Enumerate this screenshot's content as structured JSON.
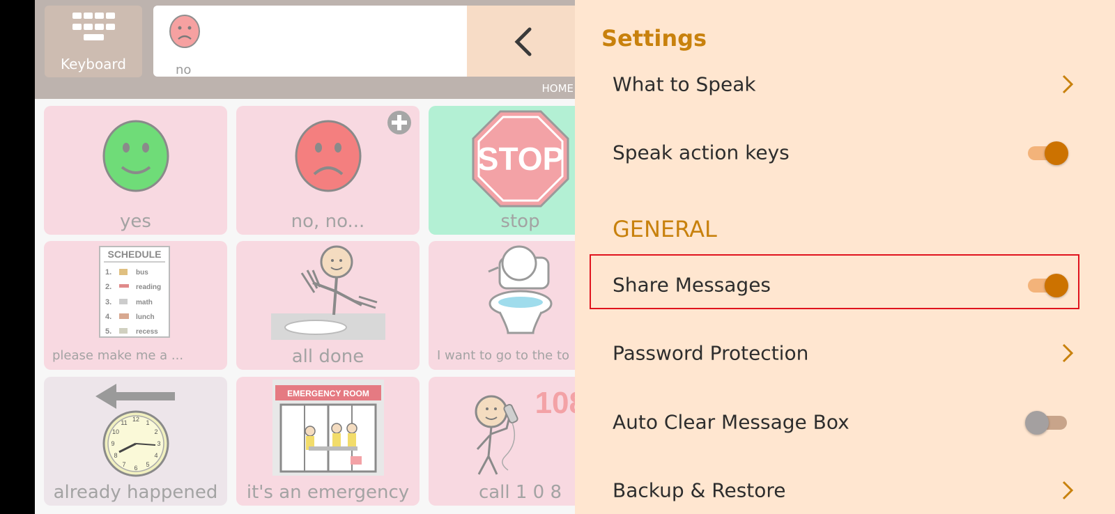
{
  "left": {
    "keyboard_label": "Keyboard",
    "message_word": "no",
    "home_label": "HOME",
    "tiles": [
      {
        "label": "yes"
      },
      {
        "label": "no, no..."
      },
      {
        "label": "stop"
      },
      {
        "label": "please make me a ..."
      },
      {
        "label": "all done"
      },
      {
        "label": "I want to go to the to"
      },
      {
        "label": "already happened"
      },
      {
        "label": "it's an emergency"
      },
      {
        "label": "call 1 0 8"
      }
    ],
    "stop_sign_text": "STOP",
    "schedule": {
      "title": "SCHEDULE",
      "items": [
        "1.",
        "bus",
        "2.",
        "reading",
        "3.",
        "math",
        "4.",
        "lunch",
        "5.",
        "recess"
      ]
    },
    "emergency_sign": "EMERGENCY ROOM",
    "phone_number": "108",
    "clock_numbers": [
      "12",
      "1",
      "2",
      "3",
      "4",
      "5",
      "6",
      "7",
      "8",
      "9",
      "10",
      "11"
    ]
  },
  "settings": {
    "title": "Settings",
    "rows": [
      {
        "label": "What to Speak",
        "control": "chevron"
      },
      {
        "label": "Speak action keys",
        "control": "toggle",
        "on": true
      },
      {
        "label": "Share Messages",
        "control": "toggle",
        "on": true
      },
      {
        "label": "Password Protection",
        "control": "chevron"
      },
      {
        "label": "Auto Clear Message Box",
        "control": "toggle",
        "on": false
      },
      {
        "label": "Backup & Restore",
        "control": "chevron"
      }
    ],
    "general_header": "GENERAL"
  },
  "colors": {
    "accent": "#cc7200",
    "section_header": "#c8810d",
    "drawer_bg": "#ffe6d0",
    "highlight": "#e0131d"
  }
}
